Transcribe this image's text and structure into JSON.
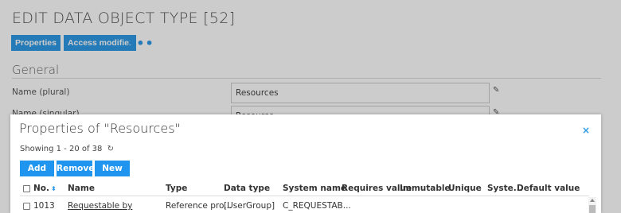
{
  "page": {
    "title": "EDIT DATA OBJECT TYPE [52]",
    "tabs": [
      "Properties",
      "Access modifier"
    ],
    "more": "•••",
    "section": "General",
    "fields": [
      {
        "label": "Name (plural)",
        "value": "Resources"
      },
      {
        "label": "Name (singular)",
        "value": "Resource"
      }
    ]
  },
  "modal": {
    "title": "Properties of \"Resources\"",
    "close": "×",
    "showing": "Showing 1 - 20 of 38",
    "buttons": {
      "add": "Add",
      "remove": "Remove",
      "new": "New"
    },
    "columns": [
      "No.",
      "Name",
      "Type",
      "Data type",
      "System name",
      "Requires value",
      "Immutable",
      "Unique",
      "Syste...",
      "Default value"
    ],
    "rows": [
      {
        "no": "1013",
        "name": "Requestable by",
        "type": "Reference pro...",
        "data_type": "[UserGroup]",
        "system_name": "C_REQUESTAB..."
      }
    ]
  },
  "colors": {
    "accent": "#2f9ae6"
  },
  "icons": {
    "edit": "edit-icon",
    "refresh": "refresh-icon",
    "close": "close-icon",
    "sort": "sort-icon"
  }
}
